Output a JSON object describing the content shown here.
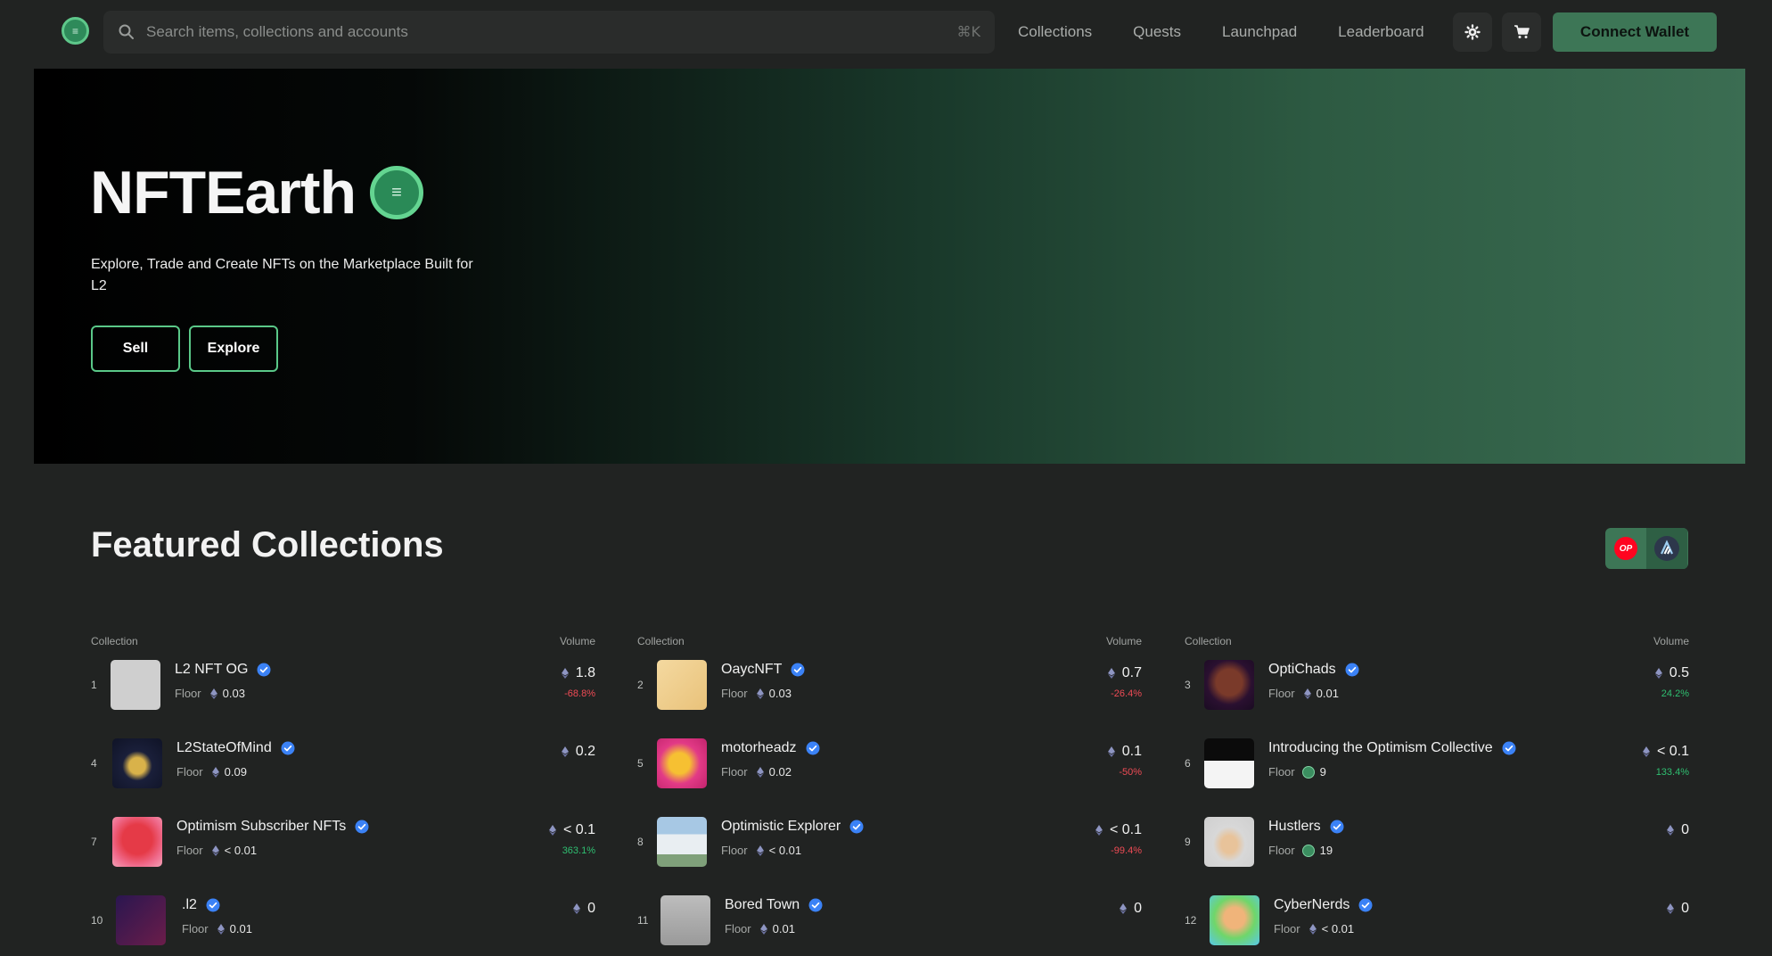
{
  "nav": {
    "search_placeholder": "Search items, collections and accounts",
    "shortcut": "⌘K",
    "links": [
      "Collections",
      "Quests",
      "Launchpad",
      "Leaderboard"
    ],
    "connect_label": "Connect Wallet"
  },
  "hero": {
    "title": "NFTEarth",
    "subtitle": "Explore, Trade and Create NFTs on the Marketplace Built for L2",
    "sell_label": "Sell",
    "explore_label": "Explore"
  },
  "featured": {
    "title": "Featured Collections",
    "col_header": "Collection",
    "vol_header": "Volume",
    "floor_label": "Floor",
    "chains": [
      {
        "name": "op",
        "label": "OP",
        "color": "#ff0420"
      },
      {
        "name": "arbitrum",
        "color": "#2d374b"
      }
    ],
    "items": [
      {
        "rank": "1",
        "name": "L2 NFT OG",
        "floor": "0.03",
        "floor_currency": "eth",
        "volume": "1.8",
        "change": "-68.8%",
        "trend": "neg"
      },
      {
        "rank": "2",
        "name": "OaycNFT",
        "floor": "0.03",
        "floor_currency": "eth",
        "volume": "0.7",
        "change": "-26.4%",
        "trend": "neg"
      },
      {
        "rank": "3",
        "name": "OptiChads",
        "floor": "0.01",
        "floor_currency": "eth",
        "volume": "0.5",
        "change": "24.2%",
        "trend": "pos"
      },
      {
        "rank": "4",
        "name": "L2StateOfMind",
        "floor": "0.09",
        "floor_currency": "eth",
        "volume": "0.2",
        "change": "",
        "trend": "none"
      },
      {
        "rank": "5",
        "name": "motorheadz",
        "floor": "0.02",
        "floor_currency": "eth",
        "volume": "0.1",
        "change": "-50%",
        "trend": "neg"
      },
      {
        "rank": "6",
        "name": "Introducing the Optimism Collective",
        "floor": "9",
        "floor_currency": "coin",
        "volume": "< 0.1",
        "change": "133.4%",
        "trend": "pos"
      },
      {
        "rank": "7",
        "name": "Optimism Subscriber NFTs",
        "floor": "< 0.01",
        "floor_currency": "eth",
        "volume": "< 0.1",
        "change": "363.1%",
        "trend": "pos"
      },
      {
        "rank": "8",
        "name": "Optimistic Explorer",
        "floor": "< 0.01",
        "floor_currency": "eth",
        "volume": "< 0.1",
        "change": "-99.4%",
        "trend": "neg"
      },
      {
        "rank": "9",
        "name": "Hustlers",
        "floor": "19",
        "floor_currency": "coin",
        "volume": "0",
        "change": "",
        "trend": "none"
      },
      {
        "rank": "10",
        "name": ".l2",
        "floor": "0.01",
        "floor_currency": "eth",
        "volume": "0",
        "change": "",
        "trend": "none"
      },
      {
        "rank": "11",
        "name": "Bored Town",
        "floor": "0.01",
        "floor_currency": "eth",
        "volume": "0",
        "change": "",
        "trend": "none"
      },
      {
        "rank": "12",
        "name": "CyberNerds",
        "floor": "< 0.01",
        "floor_currency": "eth",
        "volume": "0",
        "change": "",
        "trend": "none"
      }
    ]
  },
  "colors": {
    "accent": "#3d7656",
    "accent_light": "#5ac888",
    "negative": "#ef4b55",
    "positive": "#2fbf71",
    "background": "#212322",
    "verified": "#3b82f6"
  },
  "icons": {
    "search": "search-icon",
    "settings": "gear-icon",
    "cart": "cart-icon",
    "verified": "verified-badge-icon",
    "eth": "ethereum-icon"
  }
}
